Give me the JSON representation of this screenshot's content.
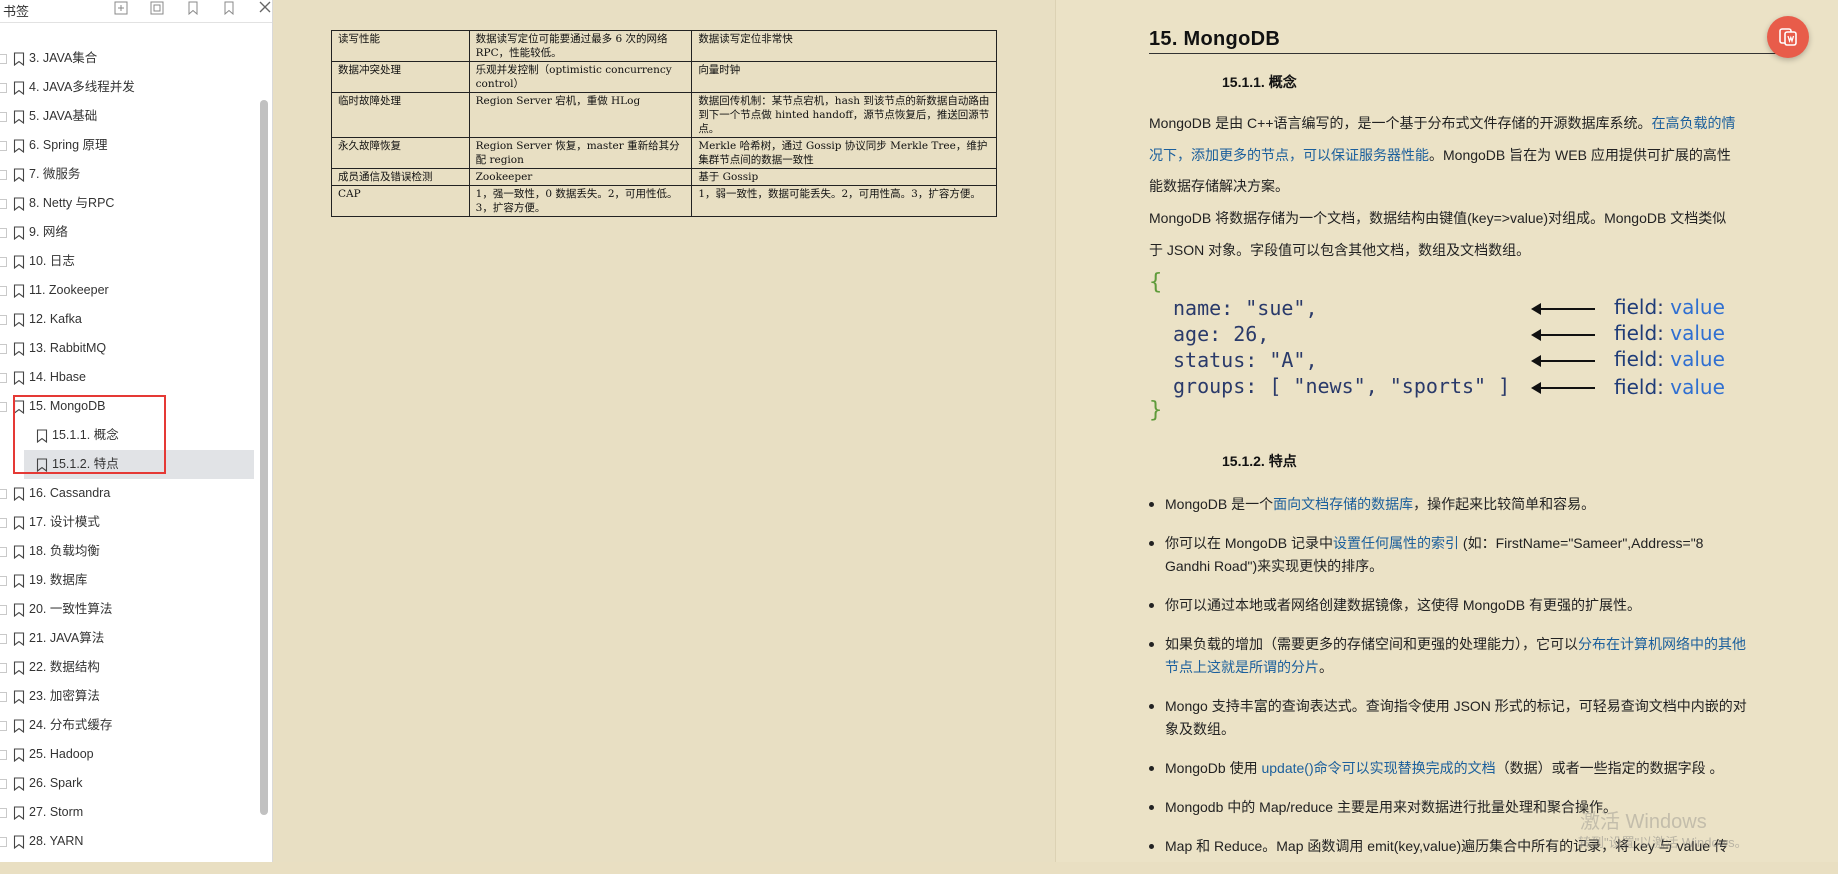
{
  "sidebar": {
    "title": "书签",
    "items": [
      {
        "label": "3. JAVA集合",
        "level": 0
      },
      {
        "label": "4. JAVA多线程并发",
        "level": 0
      },
      {
        "label": "5. JAVA基础",
        "level": 0
      },
      {
        "label": "6. Spring 原理",
        "level": 0
      },
      {
        "label": "7.   微服务",
        "level": 0
      },
      {
        "label": "8. Netty 与RPC",
        "level": 0
      },
      {
        "label": "9. 网络",
        "level": 0
      },
      {
        "label": "10. 日志",
        "level": 0
      },
      {
        "label": "11. Zookeeper",
        "level": 0
      },
      {
        "label": "12. Kafka",
        "level": 0
      },
      {
        "label": "13. RabbitMQ",
        "level": 0
      },
      {
        "label": "14. Hbase",
        "level": 0
      },
      {
        "label": "15. MongoDB",
        "level": 0
      },
      {
        "label": "15.1.1. 概念",
        "level": 1
      },
      {
        "label": "15.1.2. 特点",
        "level": 1,
        "selected": true
      },
      {
        "label": "16. Cassandra",
        "level": 0
      },
      {
        "label": "17. 设计模式",
        "level": 0
      },
      {
        "label": "18. 负载均衡",
        "level": 0
      },
      {
        "label": "19. 数据库",
        "level": 0
      },
      {
        "label": "20. 一致性算法",
        "level": 0
      },
      {
        "label": "21. JAVA算法",
        "level": 0
      },
      {
        "label": "22. 数据结构",
        "level": 0
      },
      {
        "label": "23. 加密算法",
        "level": 0
      },
      {
        "label": "24. 分布式缓存",
        "level": 0
      },
      {
        "label": "25. Hadoop",
        "level": 0
      },
      {
        "label": "26. Spark",
        "level": 0
      },
      {
        "label": "27. Storm",
        "level": 0
      },
      {
        "label": "28. YARN",
        "level": 0
      }
    ]
  },
  "table": {
    "rows": [
      [
        "读写性能",
        "数据读写定位可能要通过最多 6 次的网络 RPC，性能较低。",
        "数据读写定位非常快"
      ],
      [
        "数据冲突处理",
        "乐观并发控制（optimistic concurrency control）",
        "向量时钟"
      ],
      [
        "临时故障处理",
        "Region Server 宕机，重做 HLog",
        "数据回传机制：某节点宕机，hash 到该节点的新数据自动路由到下一个节点做 hinted handoff，源节点恢复后，推送回源节点。"
      ],
      [
        "永久故障恢复",
        "Region Server 恢复，master 重新给其分配 region",
        "Merkle 哈希树，通过 Gossip 协议同步 Merkle Tree，维护集群节点间的数据一致性"
      ],
      [
        "成员通信及错误检测",
        "Zookeeper",
        "基于 Gossip"
      ],
      [
        "CAP",
        "1，强一致性，0 数据丢失。2，可用性低。3，扩容方便。",
        "1，弱一致性，数据可能丢失。2，可用性高。3，扩容方便。"
      ]
    ]
  },
  "doc": {
    "h1": "15.   MongoDB",
    "h2_concept": "15.1.1.    概念",
    "p1_a": "MongoDB 是由 C++语言编写的，是一个基于分布式文件存储的开源数据库系统。",
    "p1_link": "在高负载的情况下，添加更多的节点，可以保证服务器性能",
    "p1_b": "。MongoDB 旨在为 WEB 应用提供可扩展的高性能数据存储解决方案。",
    "p2": "MongoDB 将数据存储为一个文档，数据结构由键值(key=>value)对组成。MongoDB 文档类似于 JSON 对象。字段值可以包含其他文档，数组及文档数组。",
    "json": {
      "open": "{",
      "close": "}",
      "lines": [
        "name: \"sue\",",
        "age: 26,",
        "status: \"A\",",
        "groups: [ \"news\", \"sports\" ]"
      ],
      "field_word": "field",
      "value_word": "value"
    },
    "h2_features": "15.1.2.    特点",
    "bullets": [
      {
        "pre": "MongoDB 是一个",
        "link": "面向文档存储的数据库",
        "post": "，操作起来比较简单和容易。"
      },
      {
        "pre": "你可以在 MongoDB 记录中",
        "link": "设置任何属性的索引",
        "post": " (如：FirstName=\"Sameer\",Address=\"8 Gandhi Road\")来实现更快的排序。"
      },
      {
        "pre": "你可以通过本地或者网络创建数据镜像，这使得 MongoDB 有更强的扩展性。",
        "link": "",
        "post": ""
      },
      {
        "pre": "如果负载的增加（需要更多的存储空间和更强的处理能力），它可以",
        "link": "分布在计算机网络中的其他节点上这就是所谓的分片",
        "post": "。"
      },
      {
        "pre": "Mongo 支持丰富的查询表达式。查询指令使用 JSON 形式的标记，可轻易查询文档中内嵌的对象及数组。",
        "link": "",
        "post": ""
      },
      {
        "pre": "MongoDb 使用 ",
        "link": "update()命令可以实现替换完成的文档",
        "post": "（数据）或者一些指定的数据字段 。"
      },
      {
        "pre": "Mongodb 中的 Map/reduce 主要是用来对数据进行批量处理和聚合操作。",
        "link": "",
        "post": ""
      },
      {
        "pre": "Map 和 Reduce。Map 函数调用 emit(key,value)遍历集合中所有的记录，将 key 与 value 传",
        "link": "",
        "post": ""
      }
    ]
  },
  "watermark": {
    "line1": "激活 Windows",
    "line2": "转到\"设置\"以激活 Windows。"
  },
  "colors": {
    "page_bg": "#e9dfc2",
    "link": "#1b5f9c",
    "highlight_border": "#e53935",
    "fab": "#e85c4a"
  }
}
